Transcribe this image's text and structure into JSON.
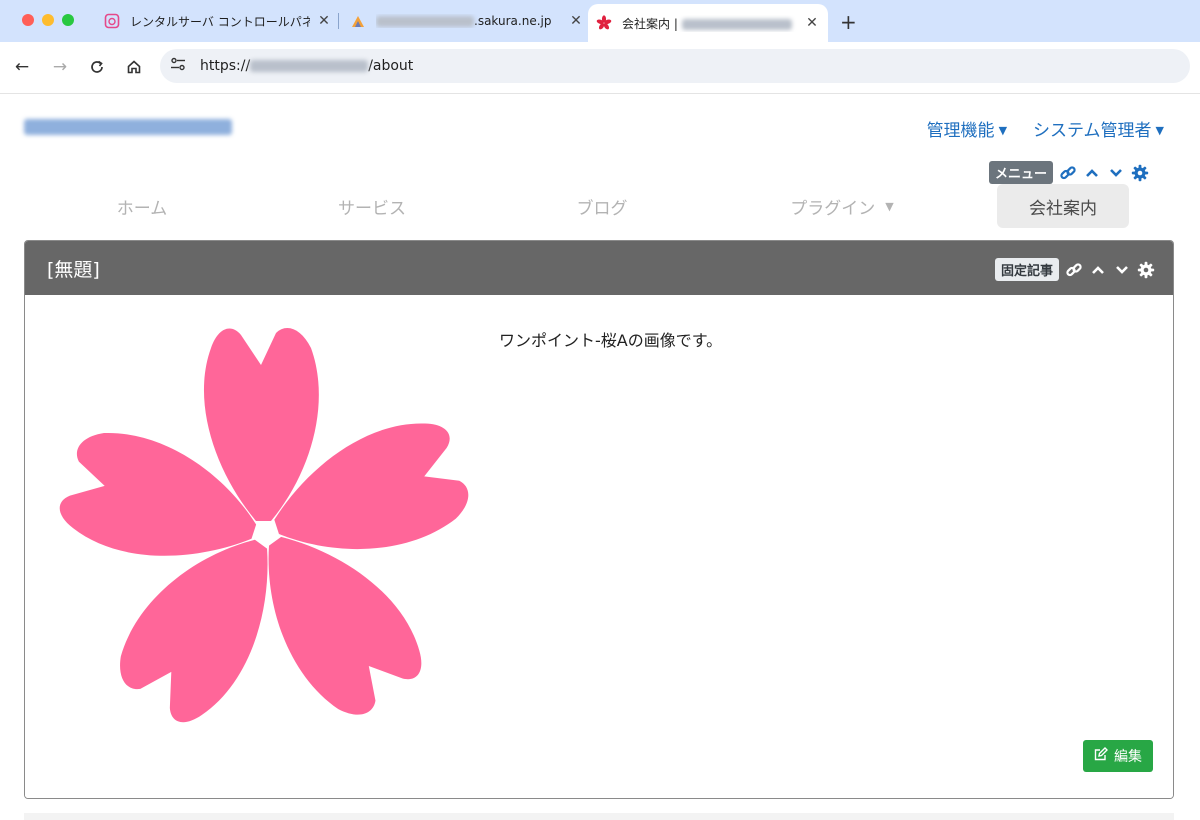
{
  "browser": {
    "tabs": [
      {
        "title": "レンタルサーバ コントロールパネ",
        "favicon": "sakura-control-panel-icon"
      },
      {
        "title_suffix": ".sakura.ne.jp",
        "favicon": "phpmyadmin-icon"
      },
      {
        "title": "会社案内 |",
        "favicon": "sakura-flower-icon",
        "active": true
      }
    ],
    "url_prefix": "https://",
    "url_path": "/about"
  },
  "header": {
    "admin_menu": "管理機能",
    "user_menu": "システム管理者"
  },
  "menu_frame": {
    "badge": "メニュー",
    "items": [
      {
        "label": "ホーム"
      },
      {
        "label": "サービス"
      },
      {
        "label": "ブログ"
      },
      {
        "label": "プラグイン",
        "has_dropdown": true
      },
      {
        "label": "会社案内",
        "active": true
      }
    ]
  },
  "content_frame": {
    "title": "[無題]",
    "badge": "固定記事",
    "description": "ワンポイント-桜Aの画像です。",
    "edit_label": "編集"
  },
  "colors": {
    "accent": "#1f6fbf",
    "petal": "#ff6699",
    "panel_header": "#676767",
    "edit_button": "#28a745"
  }
}
